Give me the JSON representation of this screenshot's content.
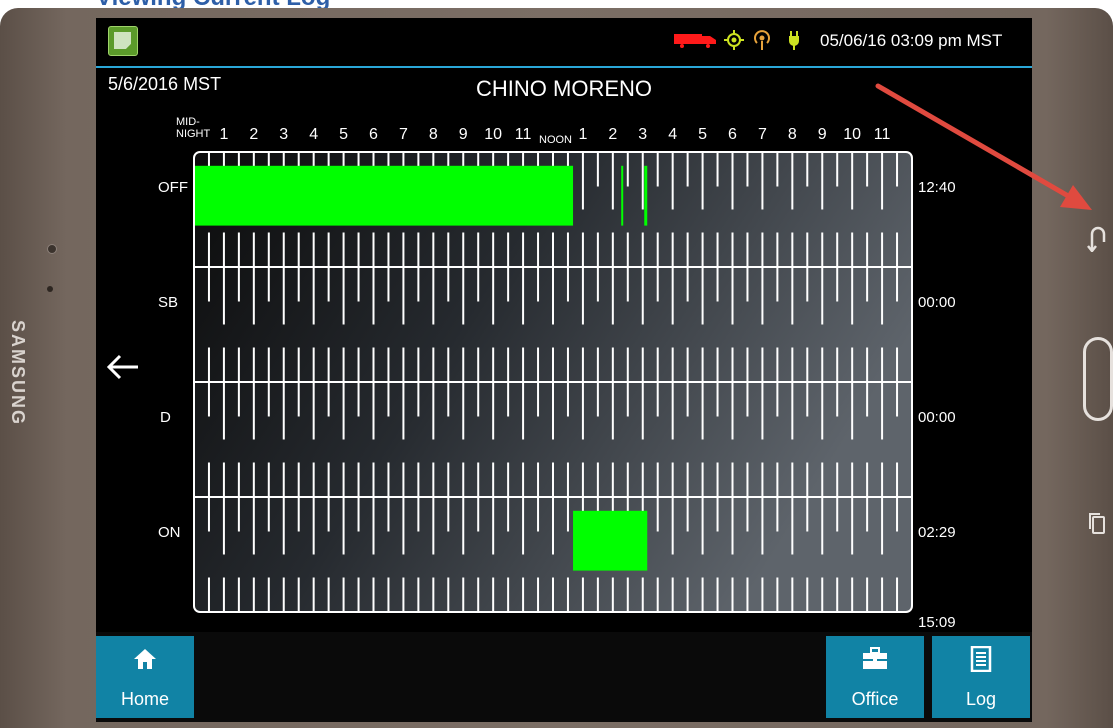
{
  "heading": "Viewing Current Log",
  "device": {
    "brand": "SAMSUNG"
  },
  "statusbar": {
    "datetime": "05/06/16 03:09 pm MST",
    "icons": [
      "truck-icon",
      "gps-icon",
      "signal-icon",
      "plug-icon"
    ],
    "truck_color": "#ff1a1a",
    "icon_color": "#cde321"
  },
  "log": {
    "date": "5/6/2016 MST",
    "driver": "CHINO MORENO",
    "hour_labels": {
      "midnight": "MID-\nNIGHT",
      "noon": "NOON",
      "am": [
        "1",
        "2",
        "3",
        "4",
        "5",
        "6",
        "7",
        "8",
        "9",
        "10",
        "11"
      ],
      "pm": [
        "1",
        "2",
        "3",
        "4",
        "5",
        "6",
        "7",
        "8",
        "9",
        "10",
        "11"
      ]
    },
    "rows": [
      {
        "status": "OFF",
        "total": "12:40"
      },
      {
        "status": "SB",
        "total": "00:00"
      },
      {
        "status": "D",
        "total": "00:00"
      },
      {
        "status": "ON",
        "total": "02:29"
      }
    ],
    "grand_total": "15:09",
    "duty_color": "#00ff00",
    "segments": [
      {
        "status": "OFF",
        "start_hour": 0,
        "end_hour": 12.67
      },
      {
        "status": "OFF",
        "start_hour": 14.28,
        "end_hour": 14.3
      },
      {
        "status": "OFF",
        "start_hour": 15.05,
        "end_hour": 15.15
      },
      {
        "status": "ON",
        "start_hour": 12.67,
        "end_hour": 15.15
      }
    ]
  },
  "nav": {
    "home": "Home",
    "office": "Office",
    "log": "Log"
  },
  "annotation_color": "#e04a3f"
}
